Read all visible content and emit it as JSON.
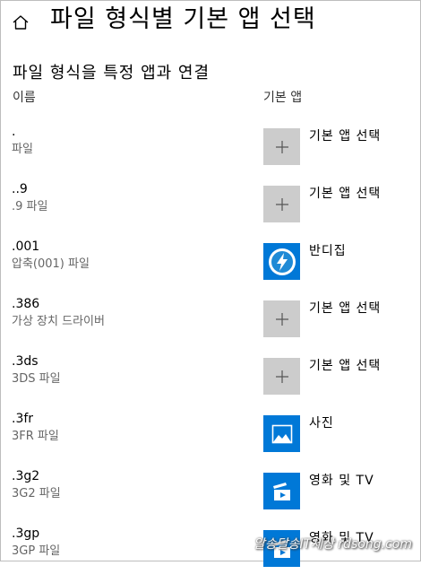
{
  "header": {
    "title": "파일 형식별 기본 앱 선택"
  },
  "section": {
    "heading": "파일 형식을 특정 앱과 연결"
  },
  "columns": {
    "name": "이름",
    "default_app": "기본 앱"
  },
  "rows": [
    {
      "ext": ".",
      "type": "파일",
      "app": "기본 앱 선택",
      "icon": "plus-icon"
    },
    {
      "ext": "..9",
      "type": ".9 파일",
      "app": "기본 앱 선택",
      "icon": "plus-icon"
    },
    {
      "ext": ".001",
      "type": "압축(001) 파일",
      "app": "반디집",
      "icon": "bandizip-icon"
    },
    {
      "ext": ".386",
      "type": "가상 장치 드라이버",
      "app": "기본 앱 선택",
      "icon": "plus-icon"
    },
    {
      "ext": ".3ds",
      "type": "3DS 파일",
      "app": "기본 앱 선택",
      "icon": "plus-icon"
    },
    {
      "ext": ".3fr",
      "type": "3FR 파일",
      "app": "사진",
      "icon": "photos-icon"
    },
    {
      "ext": ".3g2",
      "type": "3G2 파일",
      "app": "영화 및 TV",
      "icon": "movies-tv-icon"
    },
    {
      "ext": ".3gp",
      "type": "3GP 파일",
      "app": "영화 및 TV",
      "icon": "movies-tv-icon"
    }
  ],
  "watermark": "알송달송IT세상 rdsong.com",
  "colors": {
    "accent": "#0078d7",
    "tile_gray": "#cccccc",
    "secondary_text": "#666666"
  }
}
